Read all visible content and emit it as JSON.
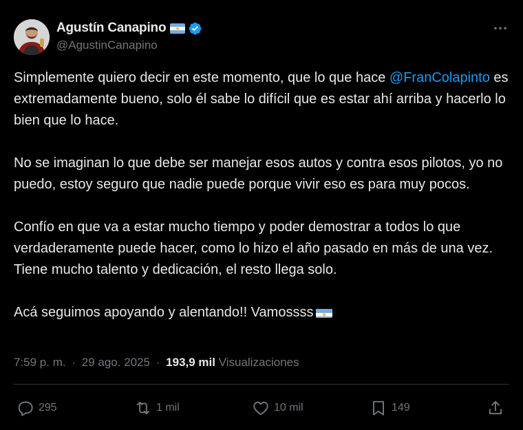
{
  "author": {
    "name": "Agustín Canapino",
    "handle": "@AgustinCanapino"
  },
  "tweet": {
    "paragraphs": [
      {
        "before": "Simplemente quiero decir en este momento, que lo que hace ",
        "mention": "@FranColapinto",
        "after": " es extremadamente bueno, solo él sabe lo difícil que es estar ahí arriba y hacerlo lo bien que lo hace."
      },
      {
        "text": "No se imaginan lo que debe ser manejar esos autos y contra esos pilotos, yo no puedo, estoy seguro que nadie puede porque vivir eso es para muy pocos."
      },
      {
        "text": "Confío en que va a estar mucho tiempo y poder demostrar a todos lo que verdaderamente puede hacer, como lo hizo el año pasado en más de una vez. Tiene mucho talento y dedicación, el resto llega solo."
      },
      {
        "text": "Acá seguimos apoyando y alentando!! Vamossss"
      }
    ]
  },
  "meta": {
    "time": "7:59 p. m.",
    "separator": "·",
    "date": "29 ago. 2025",
    "views_count": "193,9 mil",
    "views_label": "Visualizaciones"
  },
  "actions": {
    "replies": "295",
    "reposts": "1 mil",
    "likes": "10 mil",
    "bookmarks": "149"
  },
  "colors": {
    "background": "#000000",
    "text": "#e7e9ea",
    "secondary": "#71767b",
    "accent": "#1d9bf0",
    "divider": "#2f3336"
  },
  "icons": {
    "more": "more-icon",
    "verified": "verified-badge-icon",
    "flag": "argentina-flag-icon",
    "reply": "reply-icon",
    "repost": "repost-icon",
    "like": "heart-icon",
    "bookmark": "bookmark-icon",
    "share": "share-icon"
  }
}
